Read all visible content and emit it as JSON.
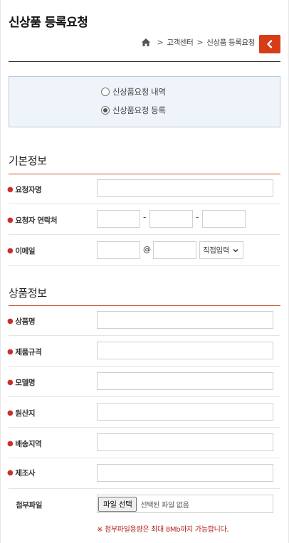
{
  "page": {
    "title": "신상품 등록요청"
  },
  "breadcrumb": {
    "items": [
      "고객센터",
      "신상품 등록요청"
    ],
    "separator": ">"
  },
  "mode": {
    "options": [
      "신상품요청 내역",
      "신상품요청 등록"
    ],
    "selected_index": 1
  },
  "basic": {
    "title": "기본정보",
    "name_label": "요청자명",
    "phone_label": "요청자 연락처",
    "phone_dash": "-",
    "email_label": "이메일",
    "email_at": "@",
    "email_domain_select": "직접입력"
  },
  "product": {
    "title": "상품정보",
    "fields": [
      "상품명",
      "제품규격",
      "모델명",
      "원산지",
      "배송지역",
      "제조사"
    ],
    "attachment_label": "첨부파일",
    "file_button": "파일 선택",
    "file_status": "선택된 파일 없음",
    "notice": "※ 첨부파일용량은 최대 8Mb까지 가능합니다."
  },
  "colors": {
    "accent": "#d63c16",
    "section_rule": "#c9502e",
    "required_dot": "#c9302c",
    "notice": "#b3261e",
    "mode_box_bg": "#eef4fa"
  },
  "icons": {
    "home": "home-icon",
    "back": "chevron-left-icon",
    "select": "chevron-down-icon"
  }
}
